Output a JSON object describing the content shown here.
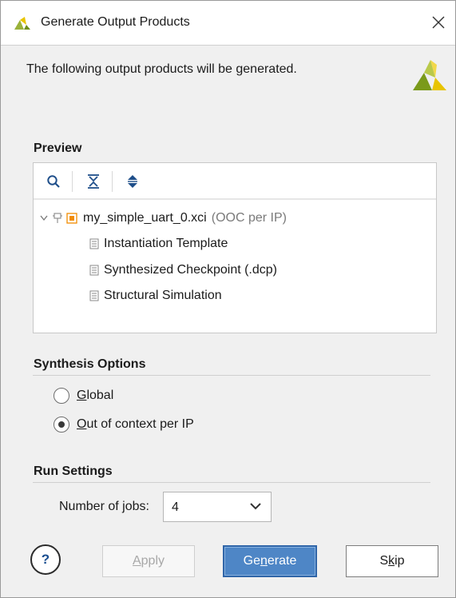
{
  "window": {
    "title": "Generate Output Products",
    "close_glyph": "✕"
  },
  "intro_text": "The following output products will be generated.",
  "preview": {
    "label": "Preview",
    "toolbar": {
      "search_icon": "search-icon",
      "collapse_icon": "collapse-all-icon",
      "expand_icon": "expand-all-icon"
    },
    "tree": {
      "root": {
        "name": "my_simple_uart_0.xci",
        "detail": "(OOC per IP)"
      },
      "children": [
        "Instantiation Template",
        "Synthesized Checkpoint (.dcp)",
        "Structural Simulation"
      ]
    }
  },
  "synthesis_options": {
    "label": "Synthesis Options",
    "options": [
      {
        "mnemonic": "G",
        "rest": "lobal",
        "checked": false
      },
      {
        "mnemonic": "O",
        "rest": "ut of context per IP",
        "checked": true
      }
    ]
  },
  "run_settings": {
    "label": "Run Settings",
    "jobs_label_prefix": "Number of ",
    "jobs_label_mnemonic": "j",
    "jobs_label_suffix": "obs:",
    "jobs_value": "4"
  },
  "buttons": {
    "help": "?",
    "apply_mnemonic": "A",
    "apply_rest": "pply",
    "generate_prefix": "Ge",
    "generate_mnemonic": "n",
    "generate_suffix": "erate",
    "skip_prefix": "S",
    "skip_mnemonic": "k",
    "skip_suffix": "ip"
  },
  "colors": {
    "accent_blue": "#4e86c6",
    "brand_green": "#7a9a1a",
    "brand_yellow": "#e8c400",
    "ip_orange": "#f08c00"
  }
}
